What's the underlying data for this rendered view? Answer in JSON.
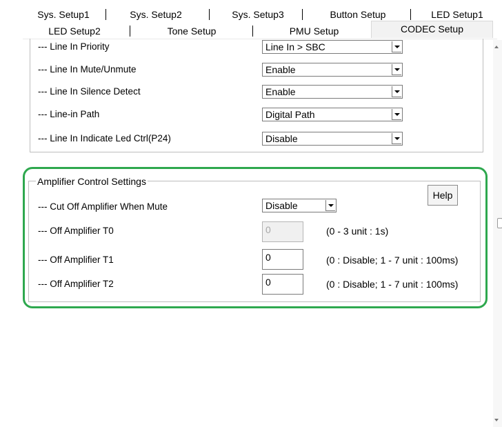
{
  "tabs": {
    "row1": [
      "Sys. Setup1",
      "Sys. Setup2",
      "Sys. Setup3",
      "Button Setup",
      "LED Setup1"
    ],
    "row2": [
      "LED Setup2",
      "Tone Setup",
      "PMU Setup",
      "CODEC Setup"
    ],
    "selected": "CODEC Setup"
  },
  "line_in": {
    "rows": [
      {
        "label": "--- Line In Priority",
        "value": "Line In > SBC"
      },
      {
        "label": "--- Line In Mute/Unmute",
        "value": "Enable"
      },
      {
        "label": "--- Line In Silence Detect",
        "value": "Enable"
      },
      {
        "label": "--- Line-in Path",
        "value": "Digital Path"
      },
      {
        "label": "--- Line In Indicate Led Ctrl(P24)",
        "value": "Disable"
      }
    ]
  },
  "amplifier": {
    "title": "Amplifier Control Settings",
    "help_label": "Help",
    "cut_off": {
      "label": "--- Cut Off Amplifier When Mute",
      "value": "Disable"
    },
    "t0": {
      "label": "--- Off Amplifier T0",
      "value": "0",
      "hint": "(0 - 3 unit : 1s)"
    },
    "t1": {
      "label": "--- Off Amplifier T1",
      "value": "0",
      "hint": "(0 : Disable; 1 - 7 unit : 100ms)"
    },
    "t2": {
      "label": "--- Off Amplifier T2",
      "value": "0",
      "hint": "(0 : Disable; 1 - 7 unit : 100ms)"
    }
  },
  "colors": {
    "highlight": "#2ea84e"
  }
}
